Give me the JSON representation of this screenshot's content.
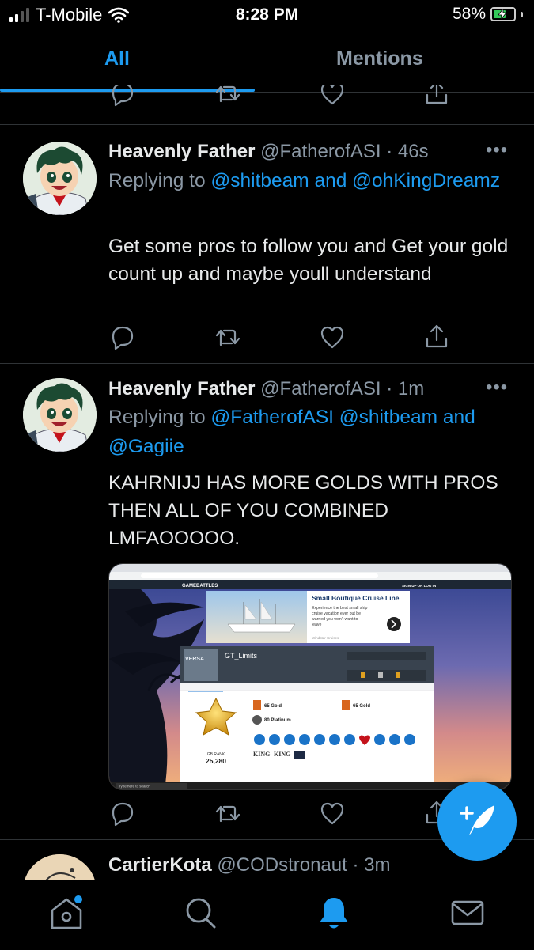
{
  "status": {
    "carrier": "T-Mobile",
    "time": "8:28 PM",
    "battery": "58%"
  },
  "tabs": [
    {
      "label": "All",
      "active": true
    },
    {
      "label": "Mentions",
      "active": false
    }
  ],
  "tweets": [
    {
      "name": "Heavenly Father",
      "handle": "@FatherofASI",
      "time": "46s",
      "replying_prefix": "Replying to",
      "replying_to": "@shitbeam and @ohKingDreamz",
      "text": "Get some pros to follow you and Get your gold count up and maybe youll understand"
    },
    {
      "name": "Heavenly Father",
      "handle": "@FatherofASI",
      "time": "1m",
      "replying_prefix": "Replying to",
      "replying_to": "@FatherofASI @shitbeam and @Gagiie",
      "text": "KAHRNIJJ HAS MORE GOLDS WITH PROS THEN ALL OF YOU COMBINED LMFAOOOOO."
    },
    {
      "name": "CartierKota",
      "handle": "@CODstronaut",
      "time": "3m"
    }
  ],
  "media": {
    "ad_title": "Small Boutique Cruise Line",
    "ad_text": "Experience the best small ship cruise vacation ever but be warned you won't want to leave",
    "ad_source": "Windstar Cruises",
    "profile_name": "GT_Limits",
    "gb_rank_label": "GB RANK",
    "gb_rank_value": "25,280",
    "gold1": "65 Gold",
    "gold2": "65 Gold",
    "platinum": "80 Platinum",
    "brand": "GAMEBATTLES",
    "signup": "SIGN UP OR LOG IN",
    "searchbar": "Type here to search"
  },
  "colors": {
    "accent": "#1d9bf0",
    "background": "#000000",
    "muted": "#8b98a5"
  },
  "icons": {
    "nav": [
      "home-icon",
      "search-icon",
      "notifications-icon",
      "messages-icon"
    ],
    "actions": [
      "reply-icon",
      "retweet-icon",
      "like-icon",
      "share-icon"
    ],
    "fab": "compose-tweet-icon"
  }
}
